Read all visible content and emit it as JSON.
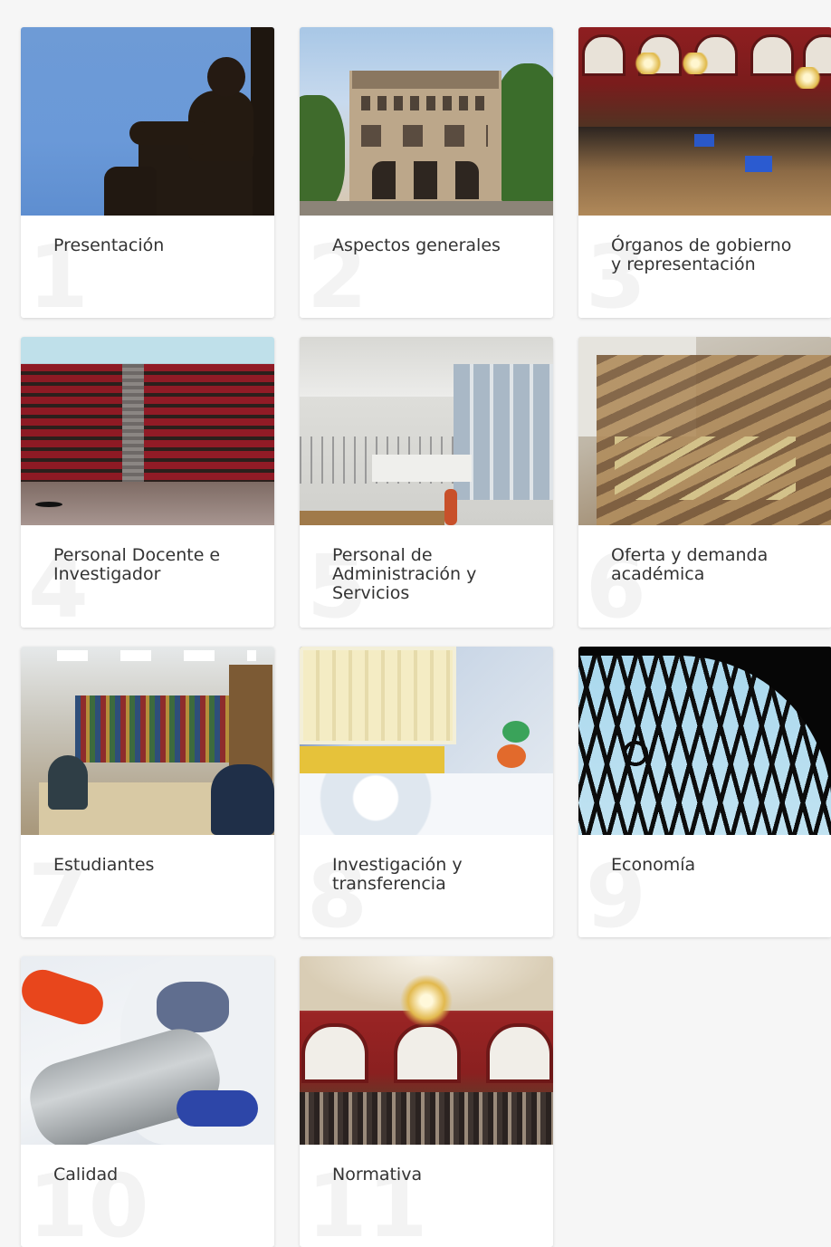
{
  "cards": [
    {
      "number": "1",
      "title": "Presentación"
    },
    {
      "number": "2",
      "title": "Aspectos generales"
    },
    {
      "number": "3",
      "title": "Órganos de gobierno y representación"
    },
    {
      "number": "4",
      "title": "Personal Docente e Investigador"
    },
    {
      "number": "5",
      "title": "Personal de Administración y Servicios"
    },
    {
      "number": "6",
      "title": "Oferta y demanda académica"
    },
    {
      "number": "7",
      "title": "Estudiantes"
    },
    {
      "number": "8",
      "title": "Investigación y transferencia"
    },
    {
      "number": "9",
      "title": "Economía"
    },
    {
      "number": "10",
      "title": "Calidad"
    },
    {
      "number": "11",
      "title": "Normativa"
    }
  ]
}
